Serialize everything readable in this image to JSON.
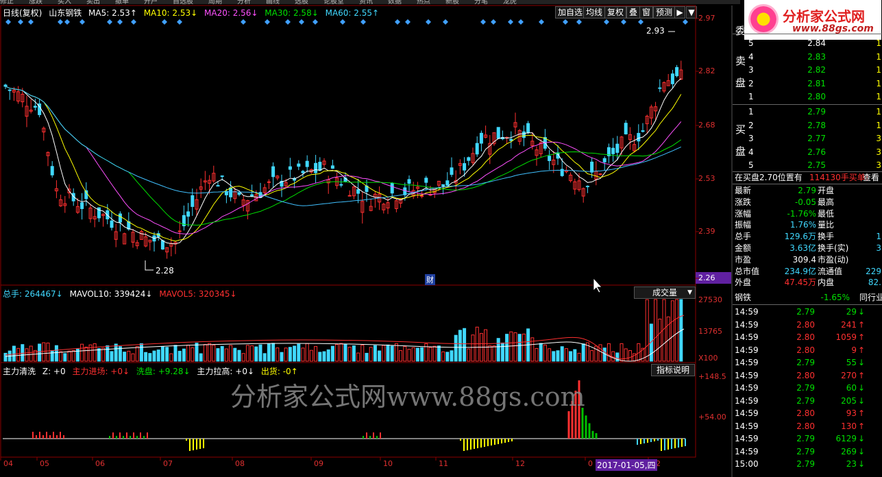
{
  "top_menu": [
    "修正",
    "涨跌",
    "买入",
    "卖出",
    "撤单",
    "开户",
    "自选股",
    "周期",
    "分析",
    "画线",
    "选股",
    "论股堂",
    "资讯",
    "数据",
    "热点",
    "新股",
    "分笔",
    "龙虎"
  ],
  "legend": {
    "period_label": "日线(复权)",
    "stock_name": "山东钢铁",
    "ma5": "MA5: 2.53↑",
    "ma10": "MA10: 2.53↓",
    "ma20": "MA20: 2.56↓",
    "ma30": "MA30: 2.58↓",
    "ma60": "MA60: 2.55↑"
  },
  "toolbar": {
    "add_watch": "加自选",
    "ma_line": "均线",
    "adjust": "复权",
    "overlay": "叠",
    "window": "窗",
    "forecast": "预测"
  },
  "colors": {
    "up": "#ff3030",
    "down": "#40d8ff",
    "ma5": "#ffffff",
    "ma10": "#ffff00",
    "ma20": "#ff50ff",
    "ma30": "#00e000",
    "ma60": "#40c0ff",
    "grid": "#8b0000"
  },
  "price_axis": [
    "2.97",
    "2.82",
    "2.68",
    "2.53",
    "2.39",
    "2.26"
  ],
  "annotations": {
    "high": "2.93",
    "low": "2.28",
    "finance_mark": "财"
  },
  "volume": {
    "total": "总手: 264467↓",
    "mavol10": "MAVOL10: 339424↓",
    "mavol5": "MAVOL5: 320345↓",
    "panel_select": "成交量",
    "axis": [
      "27530",
      "13765",
      "X100"
    ]
  },
  "indicator": {
    "name": "主力清洗",
    "z": "Z: +0",
    "enter": "主力进场: +0↓",
    "wash": "洗盘: +9.28↓",
    "pull": "主力拉高: +0↓",
    "out": "出货: -0↑",
    "help": "指标说明",
    "axis": [
      "+148.5",
      "+54.00"
    ]
  },
  "x_axis": [
    "04",
    "05",
    "06",
    "07",
    "08",
    "09",
    "10",
    "11",
    "12",
    "0",
    "02"
  ],
  "cursor_date": "2017-01-05,四",
  "watermark": "分析家公式网www.88gs.com",
  "logo": {
    "text": "分析家公式网",
    "url": "www.88gs.com"
  },
  "order_book": {
    "title_sell": "委",
    "sell_label": [
      "卖",
      "盘"
    ],
    "buy_label": [
      "买",
      "盘"
    ],
    "asks": [
      {
        "level": "5",
        "price": "2.84",
        "vol": "1"
      },
      {
        "level": "4",
        "price": "2.83",
        "vol": "1"
      },
      {
        "level": "3",
        "price": "2.82",
        "vol": "1"
      },
      {
        "level": "2",
        "price": "2.81",
        "vol": "1"
      },
      {
        "level": "1",
        "price": "2.80",
        "vol": "1"
      }
    ],
    "bids": [
      {
        "level": "1",
        "price": "2.79",
        "vol": "1"
      },
      {
        "level": "2",
        "price": "2.78",
        "vol": "1"
      },
      {
        "level": "3",
        "price": "2.77",
        "vol": "3"
      },
      {
        "level": "4",
        "price": "2.76",
        "vol": "3"
      },
      {
        "level": "5",
        "price": "2.75",
        "vol": "3"
      }
    ]
  },
  "ticker_note": {
    "a": "在买盘2.70位置有",
    "b": "114130手买单!",
    "c": "查看"
  },
  "quote": [
    {
      "l": "最新",
      "v": "2.79",
      "l2": "开盘",
      "v2": ""
    },
    {
      "l": "涨跌",
      "v": "-0.05",
      "l2": "最高",
      "v2": ""
    },
    {
      "l": "涨幅",
      "v": "-1.76%",
      "l2": "最低",
      "v2": ""
    },
    {
      "l": "振幅",
      "v": "1.76%",
      "l2": "量比",
      "v2": ""
    },
    {
      "l": "总手",
      "v": "129.6万",
      "l2": "换手",
      "v2": "1"
    },
    {
      "l": "金额",
      "v": "3.63亿",
      "l2": "换手(实)",
      "v2": "3"
    },
    {
      "l": "市盈",
      "v": "309.4",
      "l2": "市盈(动)",
      "v2": ""
    },
    {
      "l": "总市值",
      "v": "234.9亿",
      "l2": "流通值",
      "v2": "229"
    },
    {
      "l": "外盘",
      "v": "47.45万",
      "l2": "内盘",
      "v2": "82."
    }
  ],
  "industry": {
    "name": "钢铁",
    "change": "-1.65%",
    "btn": "同行业"
  },
  "ticks": [
    {
      "t": "14:59",
      "p": "2.79",
      "v": "29",
      "d": "down"
    },
    {
      "t": "14:59",
      "p": "2.80",
      "v": "241",
      "d": "up"
    },
    {
      "t": "14:59",
      "p": "2.80",
      "v": "1059",
      "d": "up"
    },
    {
      "t": "14:59",
      "p": "2.80",
      "v": "9",
      "d": "up"
    },
    {
      "t": "14:59",
      "p": "2.79",
      "v": "55",
      "d": "down"
    },
    {
      "t": "14:59",
      "p": "2.80",
      "v": "270",
      "d": "up"
    },
    {
      "t": "14:59",
      "p": "2.79",
      "v": "60",
      "d": "down"
    },
    {
      "t": "14:59",
      "p": "2.79",
      "v": "205",
      "d": "down"
    },
    {
      "t": "14:59",
      "p": "2.80",
      "v": "93",
      "d": "up"
    },
    {
      "t": "14:59",
      "p": "2.80",
      "v": "130",
      "d": "up"
    },
    {
      "t": "14:59",
      "p": "2.79",
      "v": "6129",
      "d": "down"
    },
    {
      "t": "14:59",
      "p": "2.79",
      "v": "269",
      "d": "down"
    },
    {
      "t": "15:00",
      "p": "2.79",
      "v": "23",
      "d": "down"
    }
  ]
}
